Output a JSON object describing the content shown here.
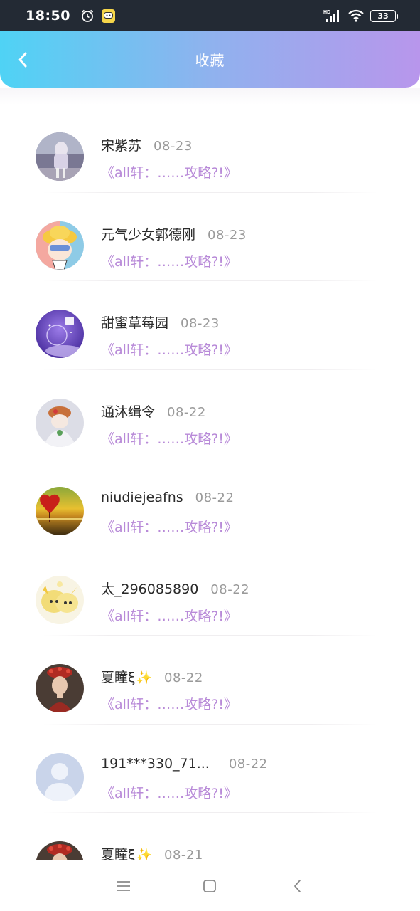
{
  "status_bar": {
    "time": "18:50",
    "battery": "33",
    "icons": [
      "alarm-icon",
      "app-notification-icon",
      "hd-signal-icon",
      "wifi-icon",
      "battery-icon"
    ]
  },
  "header": {
    "title": "收藏",
    "back_icon": "chevron-left-icon",
    "gradient": [
      "#4fd3f5",
      "#b896ec"
    ]
  },
  "favorites": [
    {
      "name": "宋紫苏",
      "date": "08-23",
      "title": "《all轩：……攻略?!》",
      "avatar": "avatar-girl-photo"
    },
    {
      "name": "元气少女郭德刚",
      "date": "08-23",
      "title": "《all轩：……攻略?!》",
      "avatar": "avatar-cartoon-hat"
    },
    {
      "name": "甜蜜草莓园",
      "date": "08-23",
      "title": "《all轩：……攻略?!》",
      "avatar": "avatar-purple-globe"
    },
    {
      "name": "通沐缉令",
      "date": "08-22",
      "title": "《all轩：……攻略?!》",
      "avatar": "avatar-pale-figure"
    },
    {
      "name": "niudiejeafns",
      "date": "08-22",
      "title": "《all轩：……攻略?!》",
      "avatar": "avatar-heart-sunset"
    },
    {
      "name": "太_296085890",
      "date": "08-22",
      "title": "《all轩：……攻略?!》",
      "avatar": "avatar-yellow-anime"
    },
    {
      "name": "夏瞳ξ",
      "date": "08-22",
      "title": "《all轩：……攻略?!》",
      "avatar": "avatar-red-costume",
      "sparkle": "✨"
    },
    {
      "name": "191***330_71...",
      "date": "08-22",
      "title": "《all轩：……攻略?!》",
      "avatar": "avatar-default"
    },
    {
      "name": "夏瞳ξ",
      "date": "08-21",
      "title": "",
      "avatar": "avatar-red-costume",
      "sparkle": "✨"
    }
  ],
  "colors": {
    "title_purple": "#b88ad8",
    "date_gray": "#9a9a9a",
    "name_dark": "#2a2a2a"
  },
  "nav_bar": {
    "icons": [
      "menu-icon",
      "home-square-icon",
      "back-chevron-icon"
    ]
  }
}
